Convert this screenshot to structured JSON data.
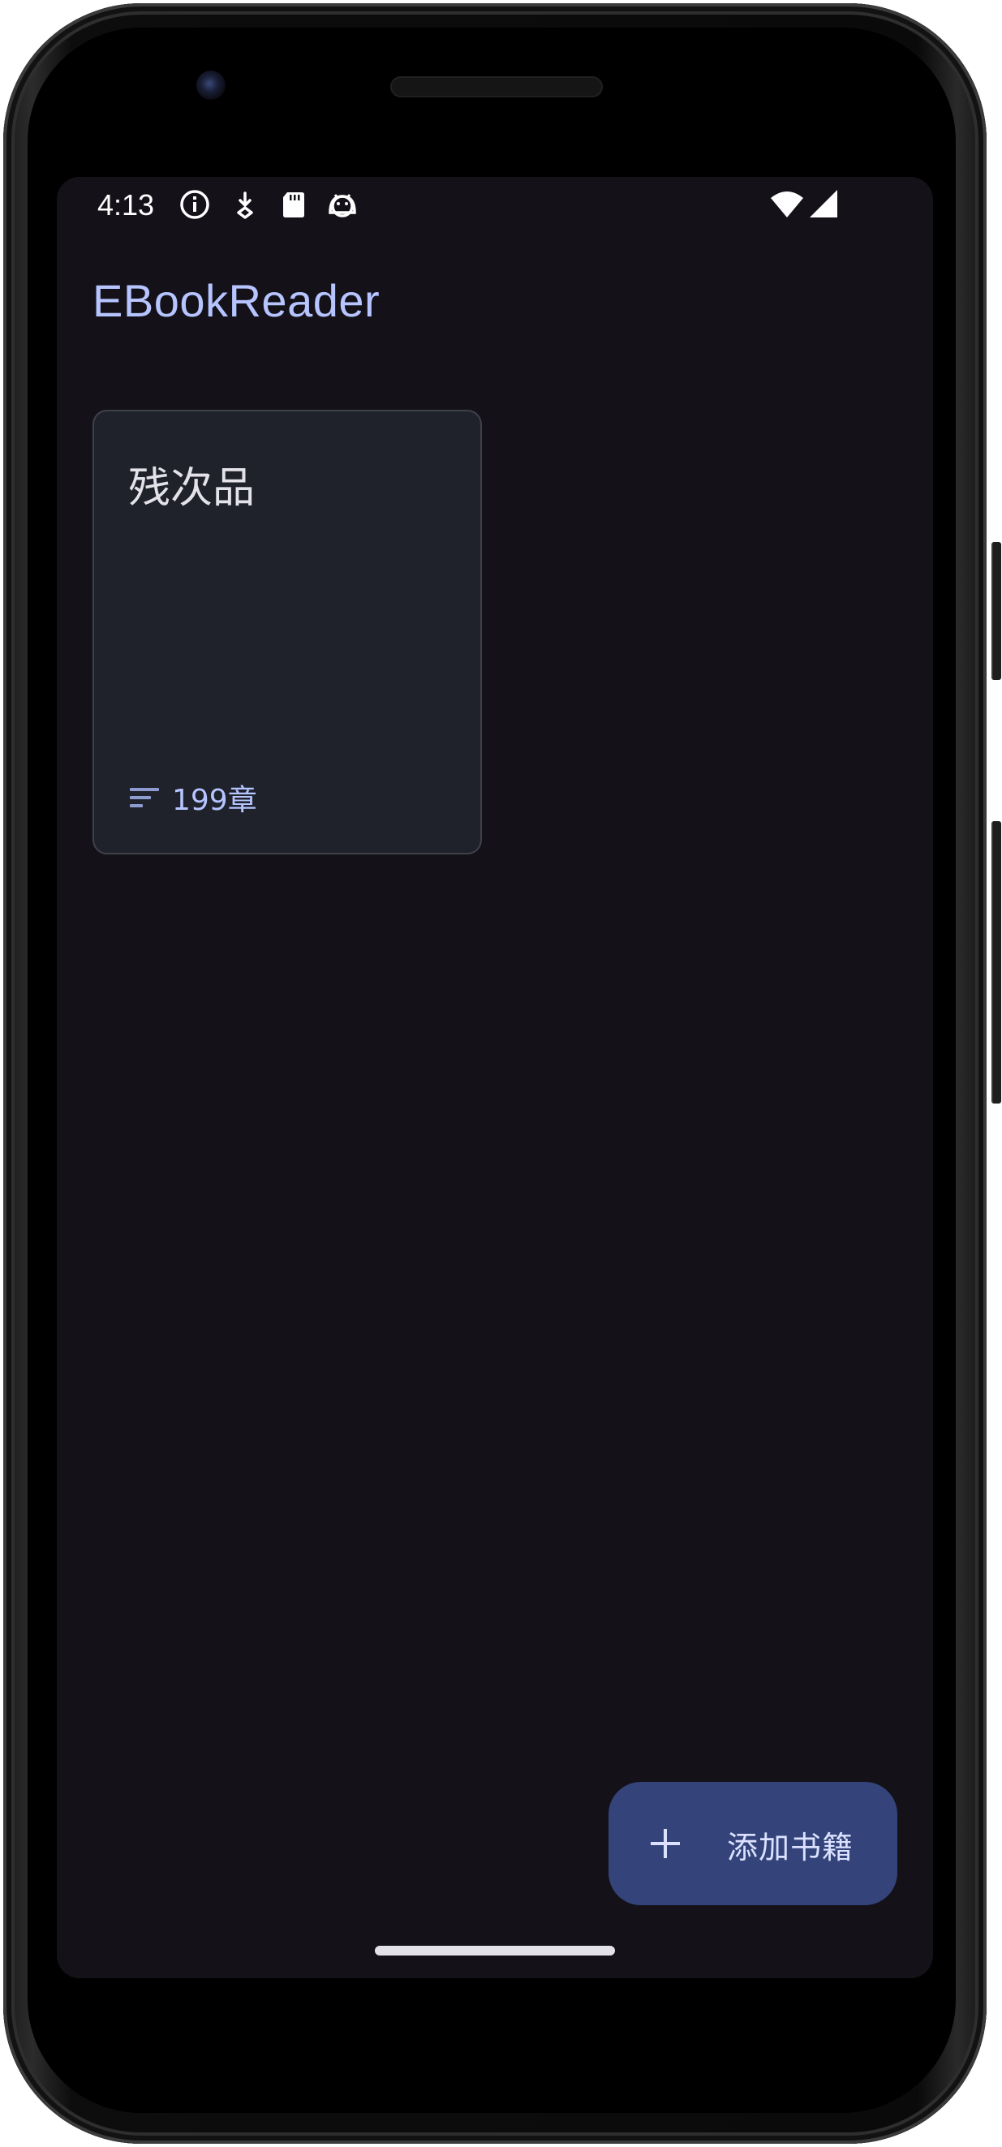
{
  "status_bar": {
    "time": "4:13",
    "icons": [
      "info-icon",
      "download-icon",
      "sd-card-icon",
      "android-debug-icon",
      "wifi-icon",
      "signal-icon"
    ]
  },
  "app_bar": {
    "title": "EBookReader"
  },
  "books": [
    {
      "title": "残次品",
      "chapters": "199章",
      "meta_icon": "list-icon"
    }
  ],
  "fab": {
    "label": "添加书籍",
    "icon": "plus-icon"
  },
  "colors": {
    "background": "#141218",
    "accent": "#b6c4ff",
    "card": "#1f222b",
    "fab": "#34447a"
  }
}
